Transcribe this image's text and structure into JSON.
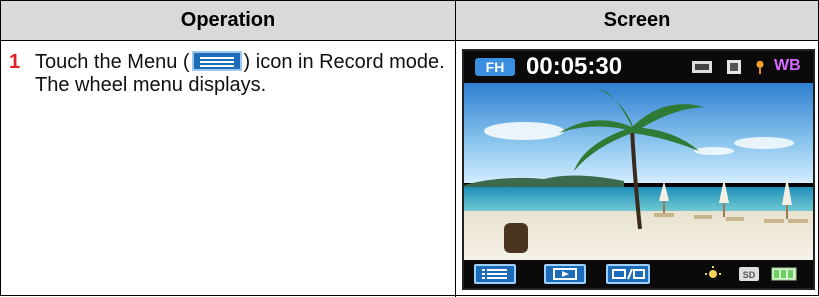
{
  "table": {
    "headers": {
      "operation": "Operation",
      "screen": "Screen"
    },
    "rows": [
      {
        "step": "1",
        "text_before": "Touch the Menu (",
        "text_after": ") icon in Record mode. The wheel menu displays.",
        "icon": "menu-icon"
      }
    ]
  },
  "camera_screen": {
    "quality_badge": "FH",
    "timer": "00:05:30",
    "white_balance": "WB",
    "top_icons": [
      "scene-mode-icon",
      "stabilizer-icon",
      "flower-macro-icon"
    ],
    "bottom_icons": [
      "menu-icon",
      "playback-icon",
      "video-photo-switch-icon",
      "light-icon",
      "sd-card-icon",
      "battery-icon"
    ]
  }
}
